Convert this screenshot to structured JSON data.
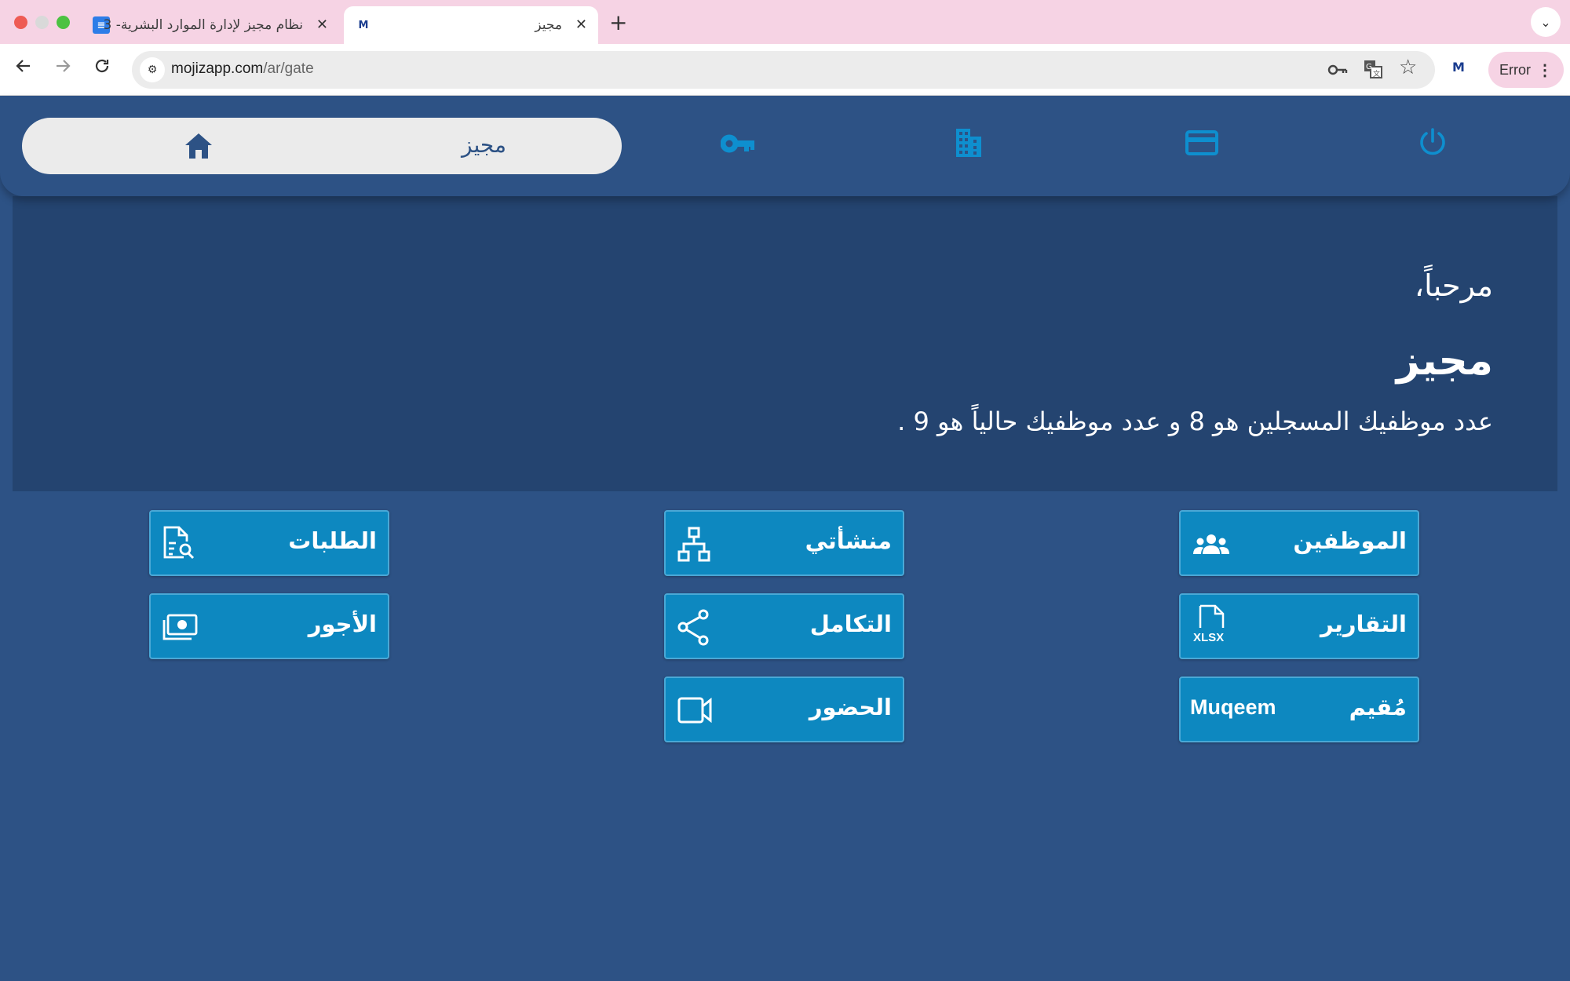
{
  "browser": {
    "tabs": [
      {
        "title": "نظام مجيز لإدارة الموارد البشرية- 3",
        "active": false,
        "favicon": "docs-icon"
      },
      {
        "title": "مجيز",
        "active": true,
        "favicon": "mojiz-logo"
      }
    ],
    "url_host": "mojizapp.com",
    "url_path": "/ar/gate",
    "profile_status": "Error",
    "favicon_letter": "M",
    "extension_letter": "M"
  },
  "header": {
    "home_label": "مجيز",
    "icons": [
      "home-icon",
      "key-icon",
      "building-icon",
      "credit-card-icon",
      "power-icon"
    ]
  },
  "welcome": {
    "greeting": "مرحباً،",
    "company_name": "مجيز",
    "employee_summary": "عدد موظفيك المسجلين هو 8 و عدد موظفيك حالياً هو 9 ."
  },
  "tiles": {
    "employees": {
      "label": "الموظفين",
      "icon": "people-icon"
    },
    "establishments": {
      "label": "منشأتي",
      "icon": "org-chart-icon"
    },
    "requests": {
      "label": "الطلبات",
      "icon": "document-search-icon"
    },
    "reports": {
      "label": "التقارير",
      "icon": "xlsx-file-icon",
      "icon_text": "XLSX"
    },
    "integration": {
      "label": "التكامل",
      "icon": "share-icon"
    },
    "payroll": {
      "label": "الأجور",
      "icon": "money-icon"
    },
    "muqeem": {
      "label": "مُقيم",
      "icon_text": "Muqeem"
    },
    "attendance": {
      "label": "الحضور",
      "icon": "video-camera-icon"
    }
  },
  "colors": {
    "page_bg": "#2d5285",
    "banner_bg": "#244470",
    "tile_bg": "#0d88c0",
    "icon_accent": "#0e8fcf",
    "tabstrip_bg": "#f6d3e4"
  }
}
